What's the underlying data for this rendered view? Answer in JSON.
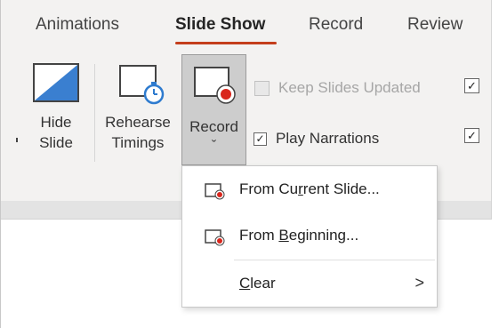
{
  "tabs": [
    "Animations",
    "Slide Show",
    "Record",
    "Review"
  ],
  "active_tab": "Slide Show",
  "buttons": {
    "hide_slide": [
      "Hide",
      "Slide"
    ],
    "rehearse_timings": [
      "Rehearse",
      "Timings"
    ],
    "record": "Record",
    "record_chevron": "ˇ"
  },
  "checkboxes": {
    "keep_slides_updated": {
      "label": "Keep Slides Updated",
      "checked": false,
      "enabled": false
    },
    "play_narrations": {
      "label": "Play Narrations",
      "checked": true,
      "enabled": true
    },
    "right_top_checked": true,
    "right_bottom_checked": true
  },
  "menu": {
    "items": [
      {
        "label_pre": "From Cu",
        "label_ul": "r",
        "label_post": "rent Slide...",
        "icon": "record-slide-icon"
      },
      {
        "label_pre": "From ",
        "label_ul": "B",
        "label_post": "eginning...",
        "icon": "record-slide-icon"
      },
      {
        "label_pre": "",
        "label_ul": "C",
        "label_post": "lear",
        "icon": "",
        "has_submenu": true
      }
    ],
    "submenu_arrow": ">"
  },
  "colors": {
    "accent_underline": "#c43e1c",
    "record_red": "#d9261c",
    "timer_blue": "#2e7bcf",
    "ribbon_bg": "#f3f2f1"
  }
}
